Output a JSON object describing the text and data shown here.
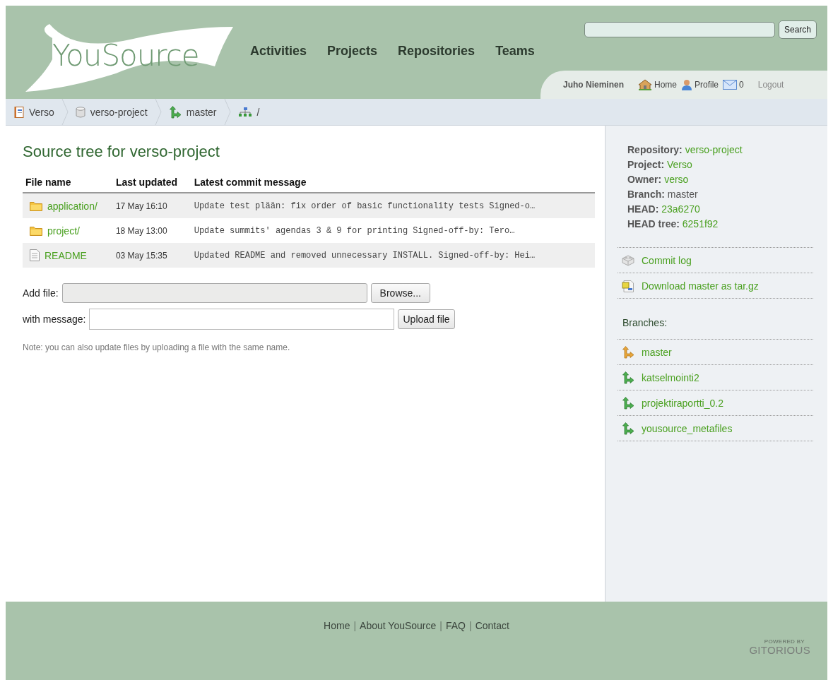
{
  "logo": {
    "text": "YouSource"
  },
  "nav": [
    "Activities",
    "Projects",
    "Repositories",
    "Teams"
  ],
  "search": {
    "button": "Search"
  },
  "user_bar": {
    "user": "Juho Nieminen",
    "links": [
      {
        "label": "Home",
        "kind": "home"
      },
      {
        "label": "Profile",
        "kind": "profile"
      },
      {
        "label": "0",
        "kind": "messages"
      },
      {
        "label": "Logout",
        "kind": "logout"
      }
    ]
  },
  "breadcrumbs": [
    {
      "label": "Verso",
      "kind": "project"
    },
    {
      "label": "verso-project",
      "kind": "repository"
    },
    {
      "label": "master",
      "kind": "branch"
    },
    {
      "label": "/",
      "kind": "tree"
    }
  ],
  "title": "Source tree for verso-project",
  "table": {
    "columns": [
      "File name",
      "Last updated",
      "Latest commit message"
    ],
    "rows": [
      {
        "name": "application/",
        "kind": "folder",
        "updated": "17 May 16:10",
        "message": "Update test plään: fix order of basic functionality tests Signed-o…"
      },
      {
        "name": "project/",
        "kind": "folder",
        "updated": "18 May 13:00",
        "message": "Update summits' agendas 3 & 9 for printing Signed-off-by: Tero…"
      },
      {
        "name": "README",
        "kind": "file",
        "updated": "03 May 15:35",
        "message": "Updated README and removed unnecessary INSTALL. Signed-off-by: Hei…"
      }
    ]
  },
  "upload": {
    "file_label": "Add file:",
    "browse": "Browse...",
    "message_label": "with message:",
    "upload": "Upload file",
    "note": "Note: you can also update files by uploading a file with the same name."
  },
  "sidebar": {
    "details": [
      {
        "label": "Repository:",
        "value": "verso-project",
        "link": true
      },
      {
        "label": "Project:",
        "value": "Verso",
        "link": true
      },
      {
        "label": "Owner:",
        "value": "verso",
        "link": true
      },
      {
        "label": "Branch:",
        "value": "master",
        "link": false
      },
      {
        "label": "HEAD:",
        "value": "23a6270",
        "link": true
      },
      {
        "label": "HEAD tree:",
        "value": "6251f92",
        "link": true
      }
    ],
    "actions": [
      {
        "label": "Commit log",
        "kind": "log"
      },
      {
        "label": "Download master as tar.gz",
        "kind": "download"
      }
    ],
    "branches_title": "Branches:",
    "branches": [
      {
        "name": "master",
        "selected": true
      },
      {
        "name": "katselmointi2",
        "selected": false
      },
      {
        "name": "projektiraportti_0.2",
        "selected": false
      },
      {
        "name": "yousource_metafiles",
        "selected": false
      }
    ]
  },
  "footer": {
    "items": [
      {
        "kind": "link",
        "text": "Home"
      },
      {
        "kind": "separator",
        "text": "|"
      },
      {
        "kind": "link",
        "text": "About YouSource"
      },
      {
        "kind": "separator",
        "text": "|"
      },
      {
        "kind": "link",
        "text": "FAQ"
      },
      {
        "kind": "separator",
        "text": "|"
      },
      {
        "kind": "link",
        "text": "Contact"
      }
    ],
    "powered_by": "POWERED BY",
    "brand": "GITORIOUS"
  }
}
